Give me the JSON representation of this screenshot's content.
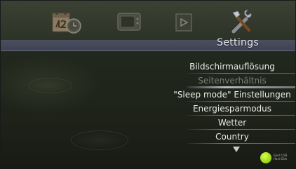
{
  "top_menu": {
    "icons": [
      {
        "name": "calendar-clock-icon"
      },
      {
        "name": "tv-icon"
      },
      {
        "name": "play-icon"
      },
      {
        "name": "tools-icon"
      }
    ],
    "selected_title": "Settings"
  },
  "settings_menu": {
    "items": [
      {
        "label": "Bildschirmauflösung",
        "state": "normal"
      },
      {
        "label": "Seitenverhältnis",
        "state": "disabled"
      },
      {
        "label": "\"Sleep mode\" Einstellungen",
        "state": "normal"
      },
      {
        "label": "Energiesparmodus",
        "state": "normal"
      },
      {
        "label": "Wetter",
        "state": "normal"
      },
      {
        "label": "Country",
        "state": "normal"
      }
    ],
    "more_indicator": "down-arrow"
  },
  "status_badge": {
    "line1": "Eject USB",
    "line2": "Hard Disk",
    "color": "#9bd60f"
  },
  "colors": {
    "background": "#22271d",
    "band": "#44485a",
    "text": "#e9ece6",
    "disabled_text": "#7b7f76"
  }
}
